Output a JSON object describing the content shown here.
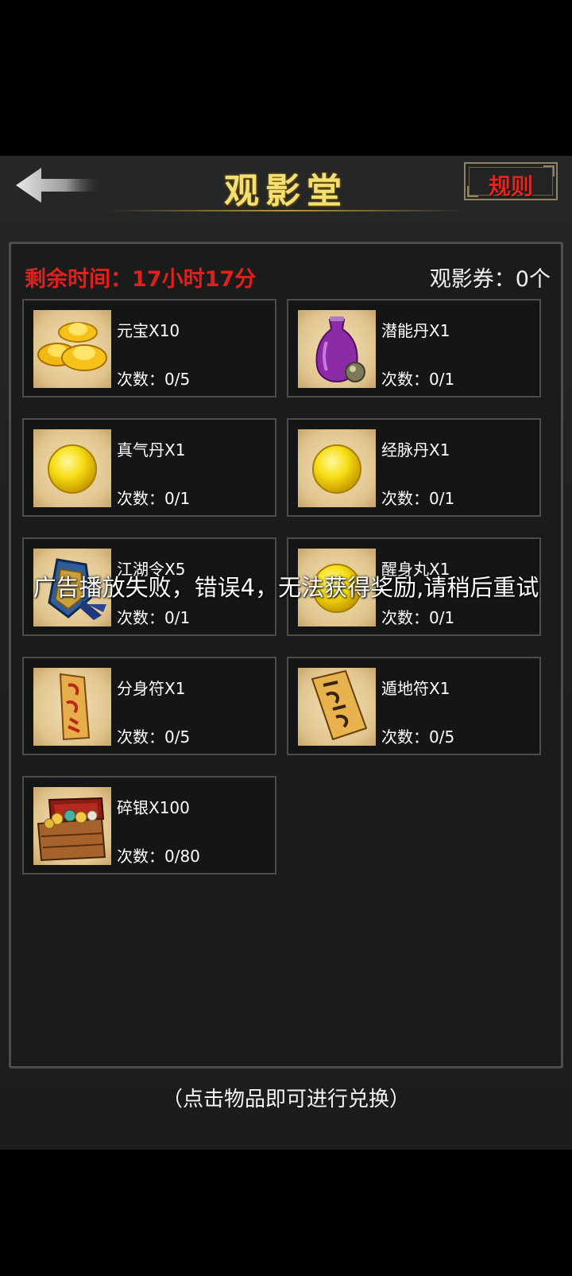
{
  "header": {
    "title": "观影堂",
    "rules_label": "规则"
  },
  "status": {
    "time_remaining": "剩余时间：17小时17分",
    "tickets": "观影券：0个"
  },
  "items": [
    {
      "name": "元宝X10",
      "count": "次数：0/5",
      "icon": "gold-ingot-icon"
    },
    {
      "name": "潜能丹X1",
      "count": "次数：0/1",
      "icon": "purple-vase-icon"
    },
    {
      "name": "真气丹X1",
      "count": "次数：0/1",
      "icon": "yellow-pill-icon"
    },
    {
      "name": "经脉丹X1",
      "count": "次数：0/1",
      "icon": "yellow-pill-icon"
    },
    {
      "name": "江湖令X5",
      "count": "次数：0/1",
      "icon": "token-icon"
    },
    {
      "name": "醒身丸X1",
      "count": "次数：0/1",
      "icon": "yellow-pill-icon"
    },
    {
      "name": "分身符X1",
      "count": "次数：0/5",
      "icon": "talisman-icon"
    },
    {
      "name": "遁地符X1",
      "count": "次数：0/5",
      "icon": "talisman-icon"
    },
    {
      "name": "碎银X100",
      "count": "次数：0/80",
      "icon": "treasure-chest-icon"
    }
  ],
  "toast": "广告播放失败，错误4，无法获得奖励,请稍后重试",
  "footer": {
    "hint": "（点击物品即可进行兑换）"
  },
  "colors": {
    "title_gold": "#f3df72",
    "alert_red": "#e0211b",
    "panel_border": "#4b4e4e"
  }
}
